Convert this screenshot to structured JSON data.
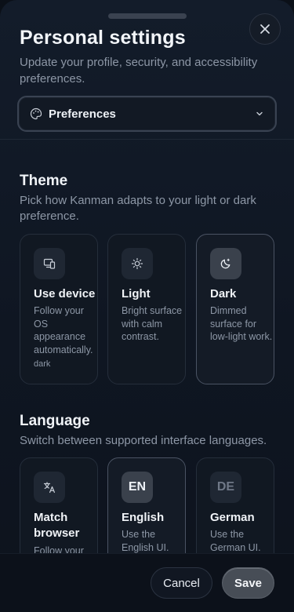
{
  "sheet": {
    "title": "Personal settings",
    "subtitle": "Update your profile, security, and accessibility preferences.",
    "close_icon": "close-icon"
  },
  "section_select": {
    "selected": "Preferences",
    "icon": "palette-icon",
    "chevron_icon": "chevron-down-icon"
  },
  "theme": {
    "title": "Theme",
    "subtitle": "Pick how Kanman adapts to your light or dark preference.",
    "options": [
      {
        "name": "Use device",
        "description": "Follow your OS appearance automatically.",
        "meta": "dark",
        "icon": "device-icon",
        "selected": false
      },
      {
        "name": "Light",
        "description": "Bright surface with calm contrast.",
        "icon": "sun-icon",
        "selected": false
      },
      {
        "name": "Dark",
        "description": "Dimmed surface for low-light work.",
        "icon": "moon-icon",
        "selected": true
      }
    ]
  },
  "language": {
    "title": "Language",
    "subtitle": "Switch between supported interface languages.",
    "options": [
      {
        "name": "Match browser",
        "description": "Follow your",
        "icon": "translate-icon",
        "selected": false
      },
      {
        "name": "English",
        "description": "Use the English UI.",
        "code": "EN",
        "selected": true
      },
      {
        "name": "German",
        "description": "Use the German UI.",
        "code": "DE",
        "selected": false
      }
    ]
  },
  "footer": {
    "cancel_label": "Cancel",
    "save_label": "Save"
  },
  "colors": {
    "background": "#0f1622",
    "card": "#111822",
    "card_selected_border": "#4a5363",
    "text_primary": "#f0f3f7",
    "text_muted": "#8d97a6"
  }
}
